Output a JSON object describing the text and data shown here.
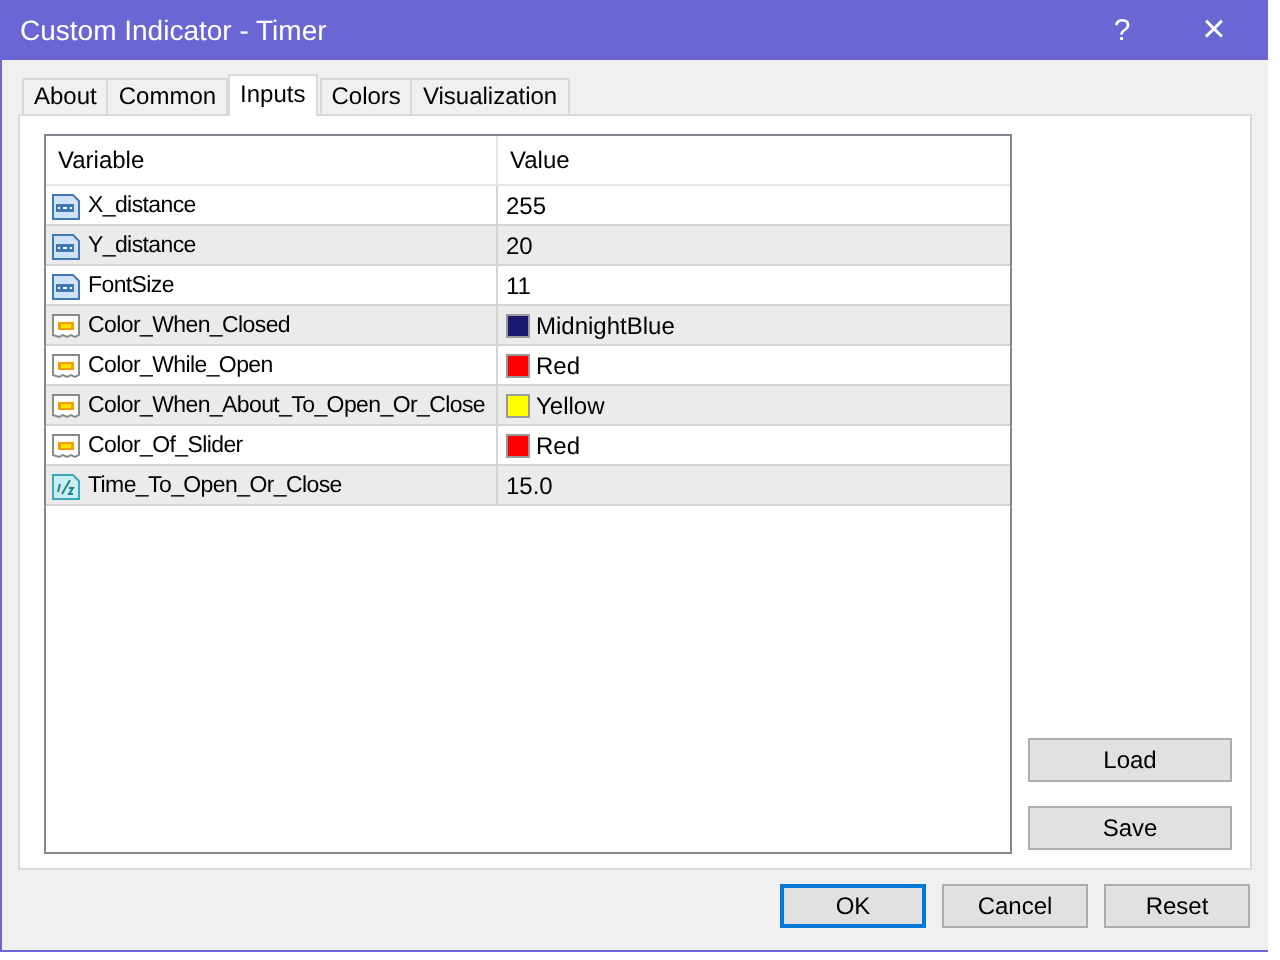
{
  "window": {
    "title": "Custom Indicator - Timer",
    "help": "?",
    "close": "×"
  },
  "tabs": [
    {
      "label": "About",
      "selected": false
    },
    {
      "label": "Common",
      "selected": false
    },
    {
      "label": "Inputs",
      "selected": true
    },
    {
      "label": "Colors",
      "selected": false
    },
    {
      "label": "Visualization",
      "selected": false
    }
  ],
  "table": {
    "columns": [
      "Variable",
      "Value"
    ],
    "rows": [
      {
        "kind": "int",
        "variable": "X_distance",
        "value": "255"
      },
      {
        "kind": "int",
        "variable": "Y_distance",
        "value": "20"
      },
      {
        "kind": "int",
        "variable": "FontSize",
        "value": "11"
      },
      {
        "kind": "color",
        "variable": "Color_When_Closed",
        "value": "MidnightBlue",
        "color": "#191970"
      },
      {
        "kind": "color",
        "variable": "Color_While_Open",
        "value": "Red",
        "color": "#ff0000"
      },
      {
        "kind": "color",
        "variable": "Color_When_About_To_Open_Or_Close",
        "value": "Yellow",
        "color": "#ffff00"
      },
      {
        "kind": "color",
        "variable": "Color_Of_Slider",
        "value": "Red",
        "color": "#ff0000"
      },
      {
        "kind": "double",
        "variable": "Time_To_Open_Or_Close",
        "value": "15.0"
      }
    ]
  },
  "side_buttons": [
    "Load",
    "Save"
  ],
  "buttons": [
    {
      "label": "OK",
      "default": true
    },
    {
      "label": "Cancel",
      "default": false
    },
    {
      "label": "Reset",
      "default": false
    }
  ]
}
